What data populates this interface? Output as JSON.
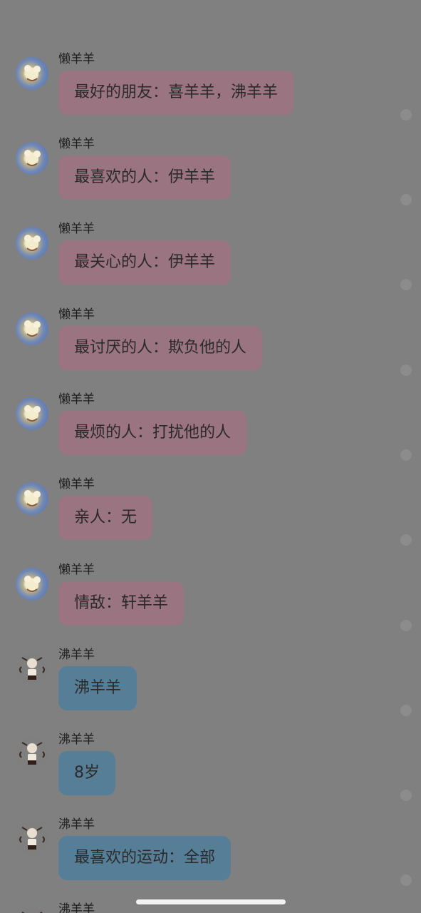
{
  "colors": {
    "overlay_bg": "#808080",
    "pink_bubble": "#9a7480",
    "blue_bubble": "#577e97"
  },
  "messages": [
    {
      "sender": "懒羊羊",
      "text": "最好的朋友：喜羊羊，沸羊羊",
      "bubble": "pink",
      "avatar": "lazy-sheep-avatar"
    },
    {
      "sender": "懒羊羊",
      "text": "最喜欢的人：伊羊羊",
      "bubble": "pink",
      "avatar": "lazy-sheep-avatar"
    },
    {
      "sender": "懒羊羊",
      "text": "最关心的人：伊羊羊",
      "bubble": "pink",
      "avatar": "lazy-sheep-avatar"
    },
    {
      "sender": "懒羊羊",
      "text": "最讨厌的人：欺负他的人",
      "bubble": "pink",
      "avatar": "lazy-sheep-avatar"
    },
    {
      "sender": "懒羊羊",
      "text": "最烦的人：打扰他的人",
      "bubble": "pink",
      "avatar": "lazy-sheep-avatar"
    },
    {
      "sender": "懒羊羊",
      "text": "亲人：无",
      "bubble": "pink",
      "avatar": "lazy-sheep-avatar"
    },
    {
      "sender": "懒羊羊",
      "text": "情敌：轩羊羊",
      "bubble": "pink",
      "avatar": "lazy-sheep-avatar"
    },
    {
      "sender": "沸羊羊",
      "text": "沸羊羊",
      "bubble": "blue",
      "avatar": "fei-sheep-avatar"
    },
    {
      "sender": "沸羊羊",
      "text": "8岁",
      "bubble": "blue",
      "avatar": "fei-sheep-avatar"
    },
    {
      "sender": "沸羊羊",
      "text": "最喜欢的运动：全部",
      "bubble": "blue",
      "avatar": "fei-sheep-avatar"
    },
    {
      "sender": "沸羊羊",
      "text": "",
      "bubble": "none",
      "avatar": "fei-sheep-avatar"
    }
  ]
}
